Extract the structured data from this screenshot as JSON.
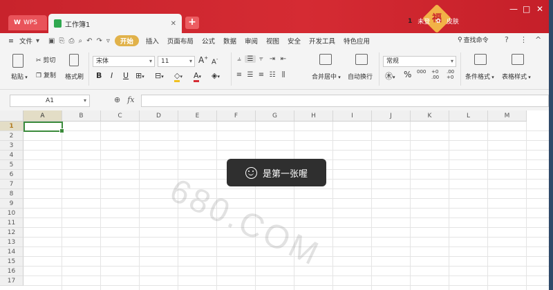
{
  "titlebar": {
    "wps_tab": "WPS",
    "doc_tab": "工作簿1",
    "new_tab": "+",
    "decor_char": "福",
    "user_num": "1",
    "user_label": "未登",
    "skin_label": "皮肤",
    "controls": [
      "—",
      "□",
      "✕"
    ]
  },
  "menubar": {
    "file": "文件",
    "tabs": [
      "开始",
      "插入",
      "页面布局",
      "公式",
      "数据",
      "审阅",
      "视图",
      "安全",
      "开发工具",
      "特色应用"
    ],
    "search": "查找命令",
    "right_icons": [
      "?",
      "⋮",
      "^"
    ]
  },
  "ribbon": {
    "paste": "粘贴",
    "cut": "剪切",
    "copy": "复制",
    "format_painter": "格式刷",
    "font_name": "宋体",
    "font_size": "11",
    "font_grow": "A",
    "font_shrink": "A",
    "bold": "B",
    "italic": "I",
    "underline": "U",
    "merge_center": "合并居中",
    "wrap_text": "自动换行",
    "number_format": "常规",
    "cond_format": "条件格式",
    "table_style": "表格样式",
    "percent": "%",
    "thousands": "000",
    "inc_decimal": "+0 .00",
    "dec_decimal": ".00 +0"
  },
  "formula_bar": {
    "name_box": "A1",
    "fx": "fx",
    "value": ""
  },
  "grid": {
    "columns": [
      "A",
      "B",
      "C",
      "D",
      "E",
      "F",
      "G",
      "H",
      "I",
      "J",
      "K",
      "L",
      "M"
    ],
    "rows": [
      "1",
      "2",
      "3",
      "4",
      "5",
      "6",
      "7",
      "8",
      "9",
      "10",
      "11",
      "12",
      "13",
      "14",
      "15",
      "16",
      "17"
    ],
    "selected_column": "A",
    "selected_row": "1",
    "watermark": "680.COM"
  },
  "toast": {
    "message": "是第一张喔"
  },
  "colors": {
    "title_red": "#c8232c",
    "active_tab": "#e1b24a",
    "selection_green": "#3a8a3a"
  }
}
